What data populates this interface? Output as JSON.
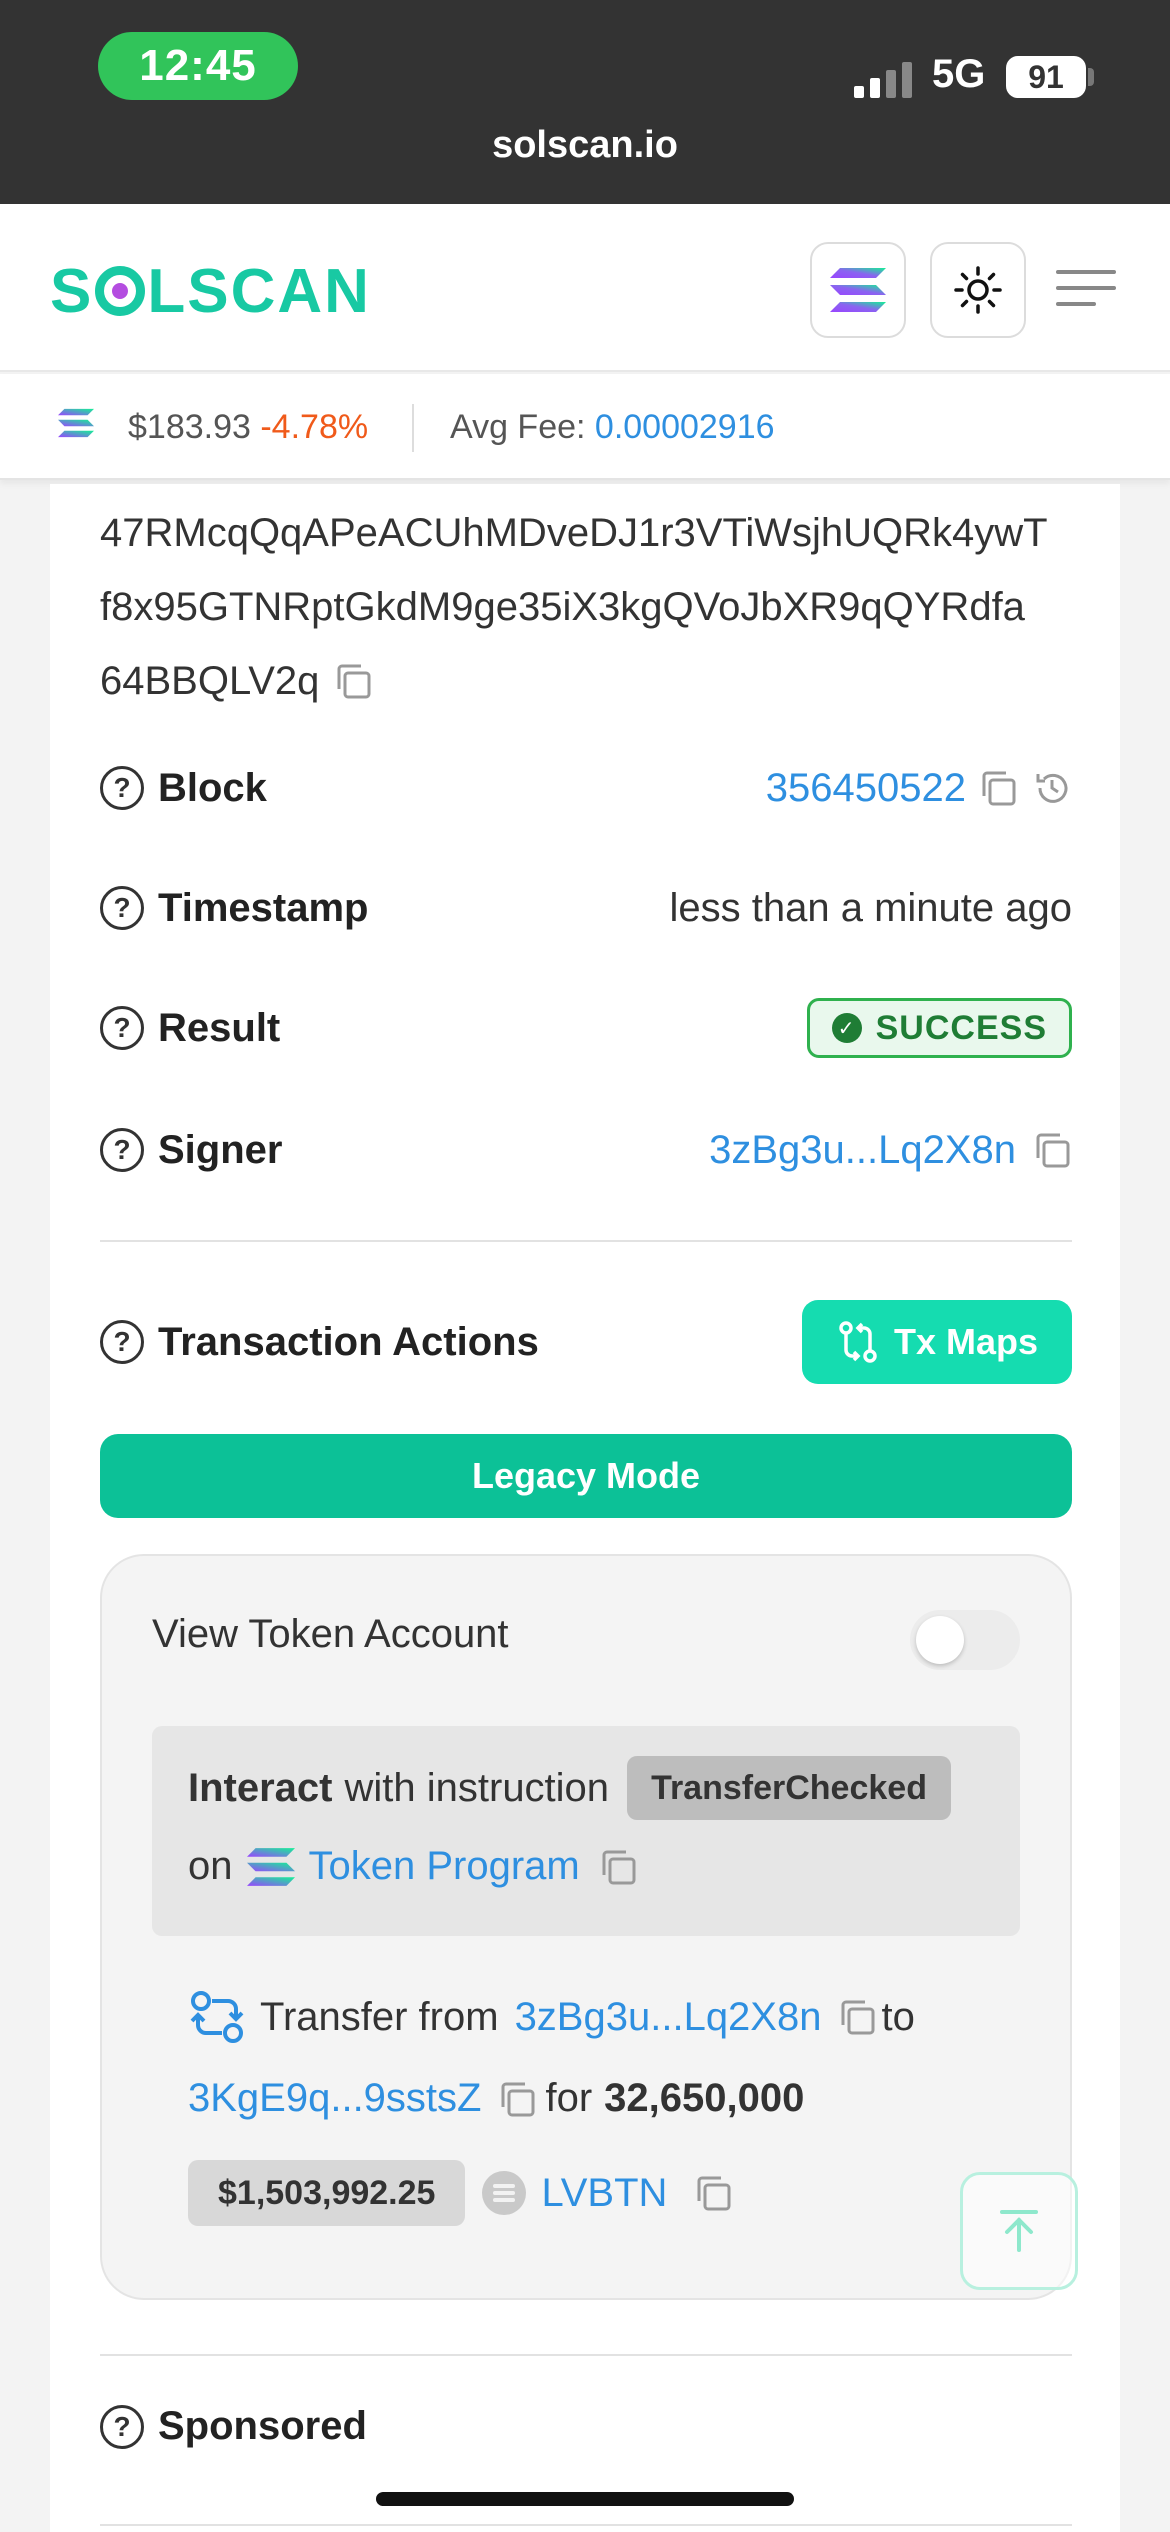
{
  "status_bar": {
    "time": "12:45",
    "network": "5G",
    "battery": "91",
    "url": "solscan.io"
  },
  "header": {
    "logo": {
      "left": "S",
      "right": "LSCAN"
    }
  },
  "ticker": {
    "price": "$183.93",
    "change": "-4.78%",
    "avg_fee_label": "Avg Fee:",
    "avg_fee_value": "0.00002916"
  },
  "signature": {
    "line1": "47RMcqQqAPeACUhMDveDJ1r3VTiWsjhUQRk4ywT",
    "line2": "f8x95GTNRptGkdM9ge35iX3kgQVoJbXR9qQYRdfa",
    "line3": "64BBQLV2q"
  },
  "details": {
    "block_label": "Block",
    "block_value": "356450522",
    "timestamp_label": "Timestamp",
    "timestamp_value": "less than a minute ago",
    "result_label": "Result",
    "result_value": "SUCCESS",
    "signer_label": "Signer",
    "signer_value": "3zBg3u...Lq2X8n"
  },
  "actions": {
    "title": "Transaction Actions",
    "tx_maps_label": "Tx Maps",
    "legacy_mode_label": "Legacy Mode",
    "view_token_account_label": "View Token Account",
    "instruction": {
      "interact": "Interact",
      "with_instruction": "with instruction",
      "instruction_name": "TransferChecked",
      "on": "on",
      "program": "Token Program"
    },
    "transfer": {
      "prefix": "Transfer from",
      "from": "3zBg3u...Lq2X8n",
      "to_word": "to",
      "to": "3KgE9q...9sstsZ",
      "for_word": "for",
      "amount": "32,650,000",
      "usd_value": "$1,503,992.25",
      "token": "LVBTN"
    }
  },
  "sponsored_label": "Sponsored",
  "colors": {
    "brand": "#18c9a3",
    "link": "#2e8fe0",
    "negative": "#f05a1a",
    "success": "#1f7d35"
  }
}
